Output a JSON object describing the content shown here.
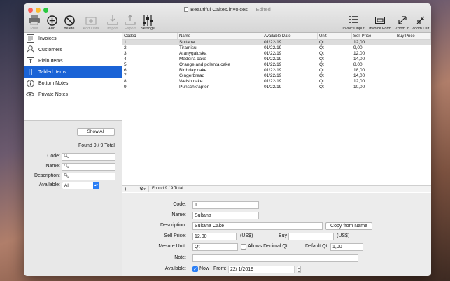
{
  "window": {
    "title": "Beautiful Cakes.invoices",
    "edited_suffix": "— Edited"
  },
  "toolbar": {
    "print": "Print",
    "add": "Add",
    "delete": "delete",
    "add_data": "Add Data",
    "import": "Import",
    "export": "Export",
    "settings": "Settings",
    "invoice_input": "Invoice Input",
    "invoice_form": "Invoice Form",
    "zoom_in": "Zoom In",
    "zoom_out": "Zoom Out"
  },
  "sidebar": {
    "items": [
      {
        "label": "Invoices",
        "icon": "invoice-icon"
      },
      {
        "label": "Customers",
        "icon": "person-icon"
      },
      {
        "label": "Plain Items",
        "icon": "text-box-icon"
      },
      {
        "label": "Tabled Items",
        "icon": "table-icon"
      },
      {
        "label": "Bottom Notes",
        "icon": "info-icon"
      },
      {
        "label": "Private Notes",
        "icon": "eye-icon"
      }
    ],
    "selected_index": 3,
    "show_all": "Show All",
    "found": "Found 9 / 9 Total",
    "filters": {
      "code_label": "Code:",
      "name_label": "Name:",
      "description_label": "Description:",
      "available_label": "Available:",
      "available_value": "All"
    }
  },
  "table": {
    "columns": [
      "Code1",
      "Name",
      "Available Date",
      "Unit",
      "Sell Price",
      "Buy Price"
    ],
    "rows": [
      [
        "1",
        "Sultana",
        "01/22/19",
        "Qt",
        "12,00",
        ""
      ],
      [
        "2",
        "Tiramisu",
        "01/22/19",
        "Qt",
        "9,00",
        ""
      ],
      [
        "3",
        "Aranygaluska",
        "01/22/19",
        "Qt",
        "12,00",
        ""
      ],
      [
        "4",
        "Madeira cake",
        "01/22/19",
        "Qt",
        "14,00",
        ""
      ],
      [
        "5",
        "Orange and polenta cake",
        "01/22/19",
        "Qt",
        "8,00",
        ""
      ],
      [
        "6",
        "Birthday cake",
        "01/22/19",
        "Qt",
        "18,00",
        ""
      ],
      [
        "7",
        "Gingerbread",
        "01/22/19",
        "Qt",
        "14,00",
        ""
      ],
      [
        "8",
        "Welsh cake",
        "01/22/19",
        "Qt",
        "12,00",
        ""
      ],
      [
        "9",
        "Punschkrapfen",
        "01/22/19",
        "Qt",
        "10,00",
        ""
      ]
    ],
    "selected_row": 0,
    "footer_found": "Found 9 / 9 Total"
  },
  "form": {
    "code_label": "Code:",
    "code": "1",
    "name_label": "Name:",
    "name": "Sultana",
    "description_label": "Description:",
    "description": "Sultana Cake",
    "copy_from_name": "Copy from Name",
    "sell_price_label": "Sell Price:",
    "sell_price": "12,00",
    "currency1": "(US$)",
    "buy_label": "Buy",
    "buy_price": "",
    "currency2": "(US$)",
    "measure_unit_label": "Mesure Unit:",
    "measure_unit": "Qt",
    "allows_decimal_label": "Allows Decimal Qt",
    "default_qt_label": "Default Qt:",
    "default_qt": "1,00",
    "note_label": "Note:",
    "note": "",
    "available_label": "Available:",
    "now_label": "Now",
    "from_label": "From:",
    "from_date": "22/ 1/2019"
  },
  "colors": {
    "selection": "#1a63d6",
    "accent": "#2a7ef5"
  }
}
